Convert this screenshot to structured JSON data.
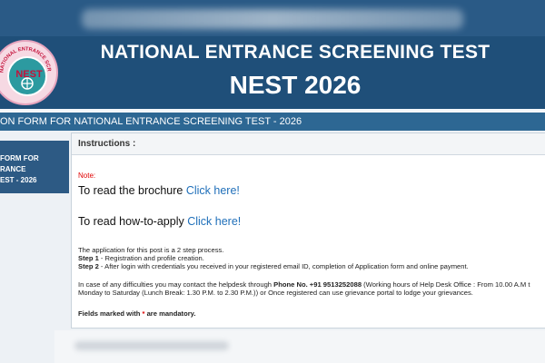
{
  "header": {
    "title": "NATIONAL ENTRANCE SCREENING TEST",
    "subtitle": "NEST 2026",
    "logo": {
      "word": "NEST",
      "ring_text": "NATIONAL ENTRANCE SCREENING"
    }
  },
  "banner": {
    "text": "ON FORM FOR NATIONAL ENTRANCE SCREENING TEST - 2026"
  },
  "sidebar": {
    "lines": [
      "FORM FOR",
      "RANCE",
      "EST - 2026"
    ]
  },
  "instructions": {
    "heading": "Instructions :",
    "note_label": "Note:",
    "brochure_text": "To read the brochure",
    "brochure_link": "Click here!",
    "howto_text": "To read how-to-apply",
    "howto_link": "Click here!",
    "process_intro": "The application for this post is a 2 step process.",
    "step1_label": "Step 1",
    "step1_text": " - Registration and profile creation.",
    "step2_label": "Step 2",
    "step2_text": " - After login with credentials you received in your registered email ID, completion of Application form and online payment.",
    "help_text_a": "In case of any difficulties you may contact the helpdesk through ",
    "help_phone": "Phone No. +91 9513252088",
    "help_text_b": " (Working hours of Help Desk Office : From 10.00 A.M t",
    "help_text_c": "Monday to Saturday (Lunch Break: 1.30 P.M. to 2.30 P.M.)) or Once registered can use grievance portal to lodge your grievances.",
    "mandatory_text": "Fields marked with ",
    "mandatory_star": "*",
    "mandatory_text_b": " are mandatory."
  },
  "colors": {
    "header_bg": "#1f4f79",
    "banner_bg": "#2d6793",
    "sidebar_bg": "#2d5a84",
    "link": "#1f6fb9",
    "note_red": "#e00000"
  }
}
